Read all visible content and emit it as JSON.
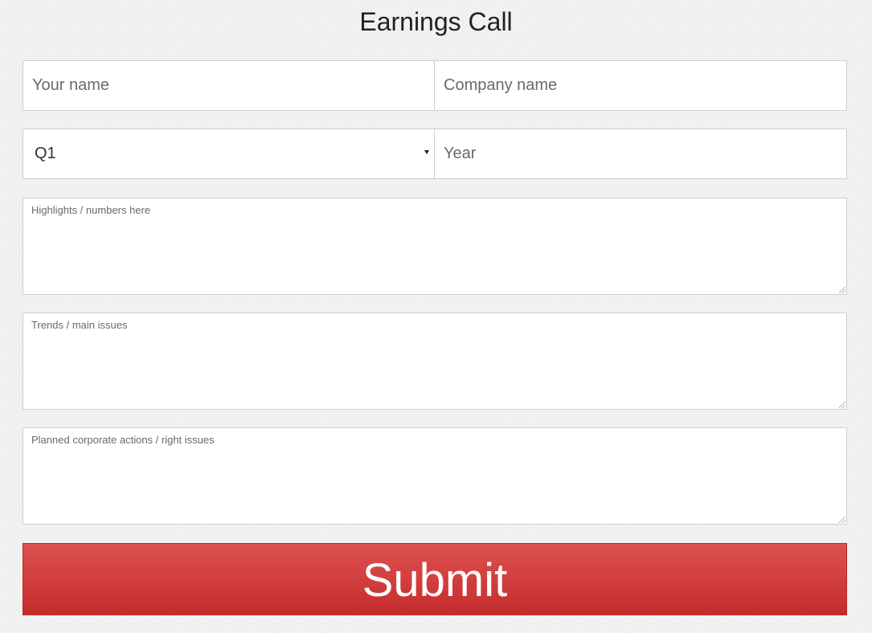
{
  "page": {
    "title": "Earnings Call"
  },
  "form": {
    "your_name": {
      "placeholder": "Your name",
      "value": ""
    },
    "company_name": {
      "placeholder": "Company name",
      "value": ""
    },
    "quarter_select": {
      "selected": "Q1"
    },
    "year": {
      "placeholder": "Year",
      "value": ""
    },
    "highlights": {
      "placeholder": "Highlights / numbers here",
      "value": ""
    },
    "trends": {
      "placeholder": "Trends / main issues",
      "value": ""
    },
    "corporate_actions": {
      "placeholder": "Planned corporate actions / right issues",
      "value": ""
    },
    "submit_label": "Submit"
  },
  "colors": {
    "submit_top": "#dd5150",
    "submit_bottom": "#c42b2b",
    "border": "#cfcfcf",
    "background": "#f3f3f3"
  },
  "icons": {
    "select_arrow": "caret-down-icon",
    "resize_grip": "resize-grip-icon"
  }
}
